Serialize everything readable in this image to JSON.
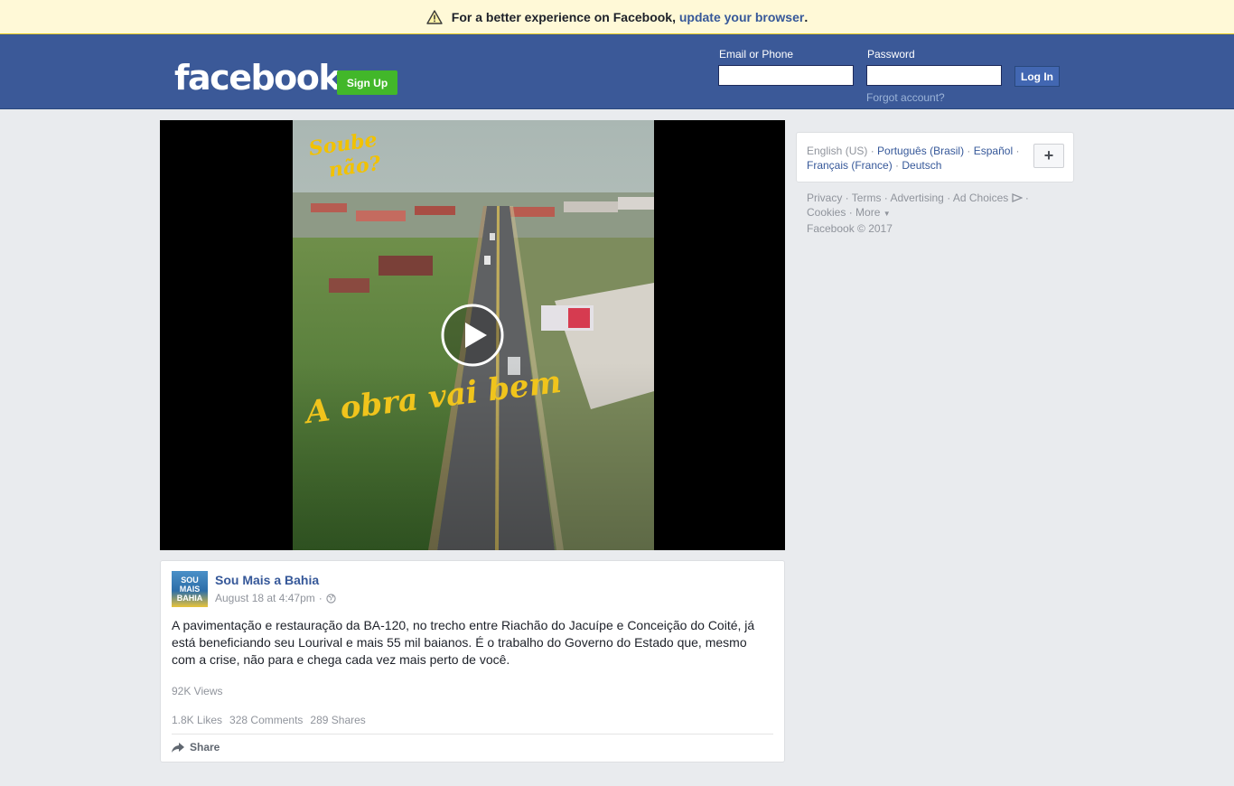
{
  "banner": {
    "text": "For a better experience on Facebook, ",
    "link": "update your browser",
    "suffix": "."
  },
  "header": {
    "logo": "facebook",
    "signup_label": "Sign Up",
    "email_label": "Email or Phone",
    "password_label": "Password",
    "email_value": "",
    "password_value": "",
    "login_label": "Log In",
    "forgot_label": "Forgot account?"
  },
  "video": {
    "overlay_top": "Soube não?",
    "overlay_caption": "A obra vai bem"
  },
  "post": {
    "author": "Sou Mais a Bahia",
    "avatar_text": [
      "SOU",
      "MAIS",
      "BAHIA"
    ],
    "timestamp": "August 18 at 4:47pm",
    "separator": "·",
    "text": "A pavimentação e restauração da BA-120, no trecho entre Riachão do Jacuípe e Conceição do Coité, já está beneficiando seu Lourival e mais 55 mil baianos. É o trabalho do Governo do Estado que, mesmo com a crise, não para e chega cada vez mais perto de você.",
    "views": "92K Views",
    "likes": "1.8K Likes",
    "comments": "328 Comments",
    "shares": "289 Shares",
    "share_label": "Share"
  },
  "languages": {
    "current": "English (US)",
    "items": [
      "Português (Brasil)",
      "Español",
      "Français (France)",
      "Deutsch"
    ],
    "plus_label": "+"
  },
  "footer": {
    "privacy": "Privacy",
    "terms": "Terms",
    "advertising": "Advertising",
    "ad_choices": "Ad Choices",
    "cookies": "Cookies",
    "more": "More",
    "copyright": "Facebook © 2017"
  },
  "colors": {
    "brand_blue": "#3b5998",
    "link_blue": "#365899",
    "signup_green": "#42b72a",
    "banner_yellow": "#fff9d7",
    "page_bg": "#e9ebee"
  },
  "icons": [
    "warning-icon",
    "play-icon",
    "globe-icon",
    "share-arrow-icon",
    "ad-choices-icon",
    "plus-icon"
  ]
}
